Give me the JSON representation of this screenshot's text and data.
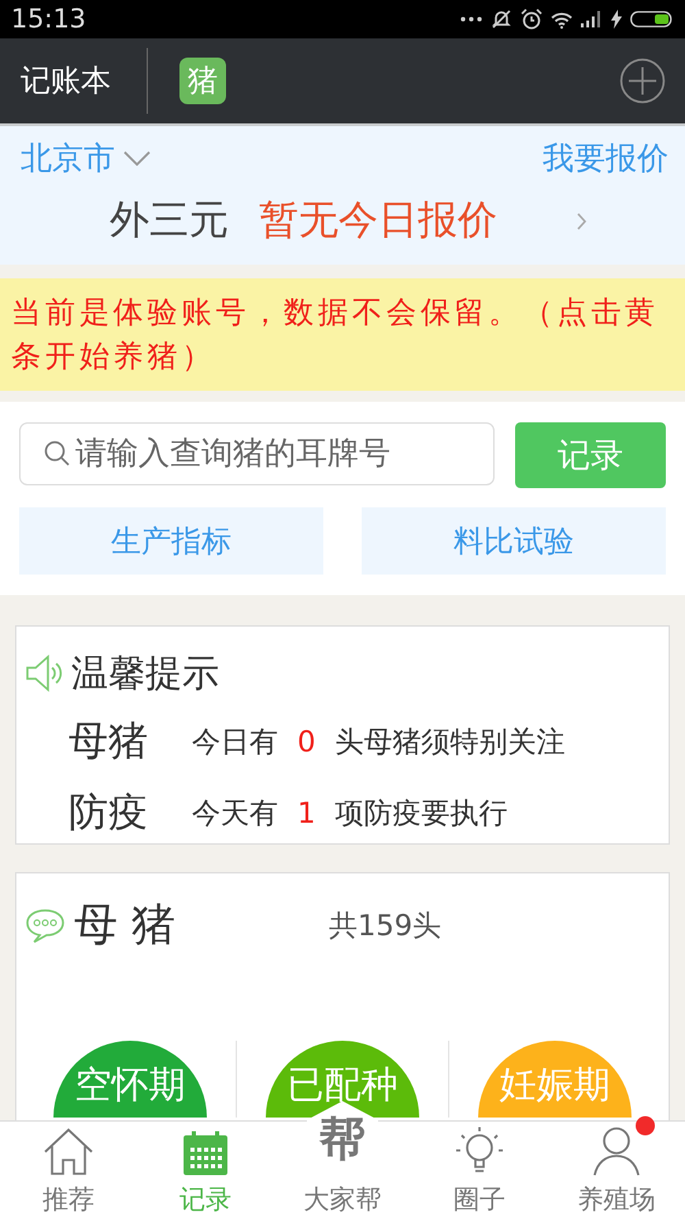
{
  "status_bar": {
    "time": "15:13"
  },
  "app_bar": {
    "title": "记账本",
    "badge": "猪"
  },
  "quote": {
    "city": "北京市",
    "report_link": "我要报价",
    "breed": "外三元",
    "price": "暂无今日报价"
  },
  "notice": "当前是体验账号，数据不会保留。（点击黄条开始养猪）",
  "search": {
    "placeholder": "请输入查询猪的耳牌号",
    "button": "记录"
  },
  "shortcuts": [
    "生产指标",
    "料比试验"
  ],
  "tips": {
    "title": "温馨提示",
    "rows": [
      {
        "label": "母猪",
        "prefix": "今日有",
        "count": "0",
        "suffix": "头母猪须特别关注"
      },
      {
        "label": "防疫",
        "prefix": "今天有",
        "count": "1",
        "suffix": "项防疫要执行"
      }
    ]
  },
  "sows": {
    "title": "母 猪",
    "total": "共159头",
    "stages": [
      {
        "label": "空怀期",
        "color": "#22ab3a"
      },
      {
        "label": "已配种",
        "color": "#5cbb0a"
      },
      {
        "label": "妊娠期",
        "color": "#fdb21b"
      }
    ]
  },
  "bottom_nav": [
    {
      "label": "推荐",
      "kind": "home",
      "selected": false,
      "badge": false
    },
    {
      "label": "记录",
      "kind": "calendar",
      "selected": true,
      "badge": false
    },
    {
      "label": "大家帮",
      "kind": "hex",
      "icon_text": "帮",
      "selected": false,
      "badge": false
    },
    {
      "label": "圈子",
      "kind": "bulb",
      "selected": false,
      "badge": false
    },
    {
      "label": "养殖场",
      "kind": "person",
      "selected": false,
      "badge": true
    }
  ]
}
